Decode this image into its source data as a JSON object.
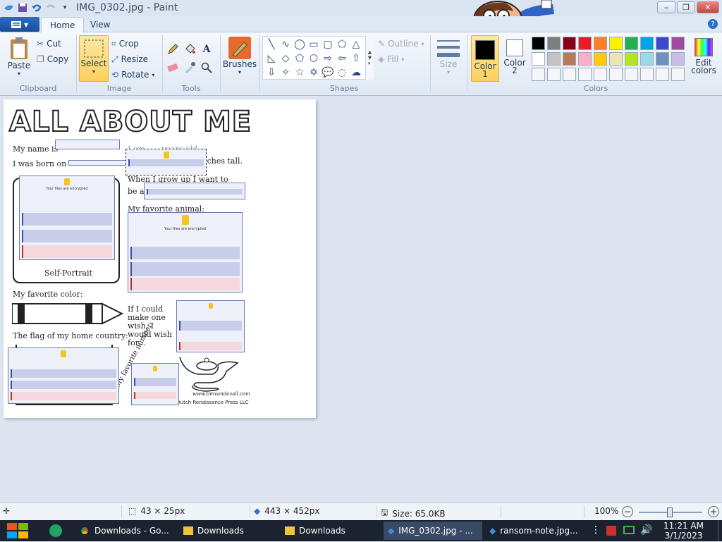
{
  "window": {
    "title": "IMG_0302.jpg - Paint",
    "controls": {
      "minimize": "‒",
      "maximize": "❐",
      "close": "✕"
    }
  },
  "tabs": {
    "file": "▾",
    "home": "Home",
    "view": "View"
  },
  "ribbon": {
    "clipboard": {
      "label": "Clipboard",
      "paste": "Paste",
      "cut": "Cut",
      "copy": "Copy"
    },
    "image": {
      "label": "Image",
      "select": "Select",
      "crop": "Crop",
      "resize": "Resize",
      "rotate": "Rotate"
    },
    "tools": {
      "label": "Tools"
    },
    "brushes": {
      "label": "Brushes"
    },
    "shapes": {
      "label": "Shapes",
      "outline": "Outline",
      "fill": "Fill"
    },
    "size": {
      "label": "Size"
    },
    "colors": {
      "label": "Colors",
      "color1": "Color 1",
      "color2": "Color 2",
      "edit": "Edit colors",
      "color1_value": "#000000",
      "color2_value": "#ffffff",
      "palette_row1": [
        "#000000",
        "#7f7f7f",
        "#880015",
        "#ed1c24",
        "#ff7f27",
        "#fff200",
        "#22b14c",
        "#00a2e8",
        "#3f48cc",
        "#a349a4"
      ],
      "palette_row2": [
        "#ffffff",
        "#c3c3c3",
        "#b97a57",
        "#ffaec9",
        "#ffc90e",
        "#efe4b0",
        "#b5e61d",
        "#99d9ea",
        "#7092be",
        "#c8bfe7"
      ]
    }
  },
  "worksheet": {
    "title": "ALL ABOUT ME",
    "name_label": "My name is",
    "age_label": "I am ___ years old",
    "born_label": "I was born on",
    "tall_label": "inches tall.",
    "grow_label": "When I grow up I want to",
    "be_label": "be a",
    "animal_label": "My favorite animal:",
    "portrait_label": "Self-Portrait",
    "color_label": "My favorite color:",
    "wish_label": "If I could make one wish, I would wish for...",
    "flag_label": "The flag of my home country:",
    "number_label": "My favorite number:",
    "site": "www.timvandevall.com",
    "copyright": "© 2013 Dutch Renaissance Press LLC",
    "popup_title": "Your files are encrypted"
  },
  "status": {
    "selection_size": "43 × 25px",
    "image_size": "443 × 452px",
    "file_size": "Size: 65.0KB",
    "zoom": "100%"
  },
  "taskbar": {
    "items": [
      "Downloads - Go...",
      "Downloads",
      "Downloads",
      "IMG_0302.jpg - ...",
      "ransom-note.jpg..."
    ],
    "time": "11:21 AM",
    "date": "3/1/2023"
  }
}
